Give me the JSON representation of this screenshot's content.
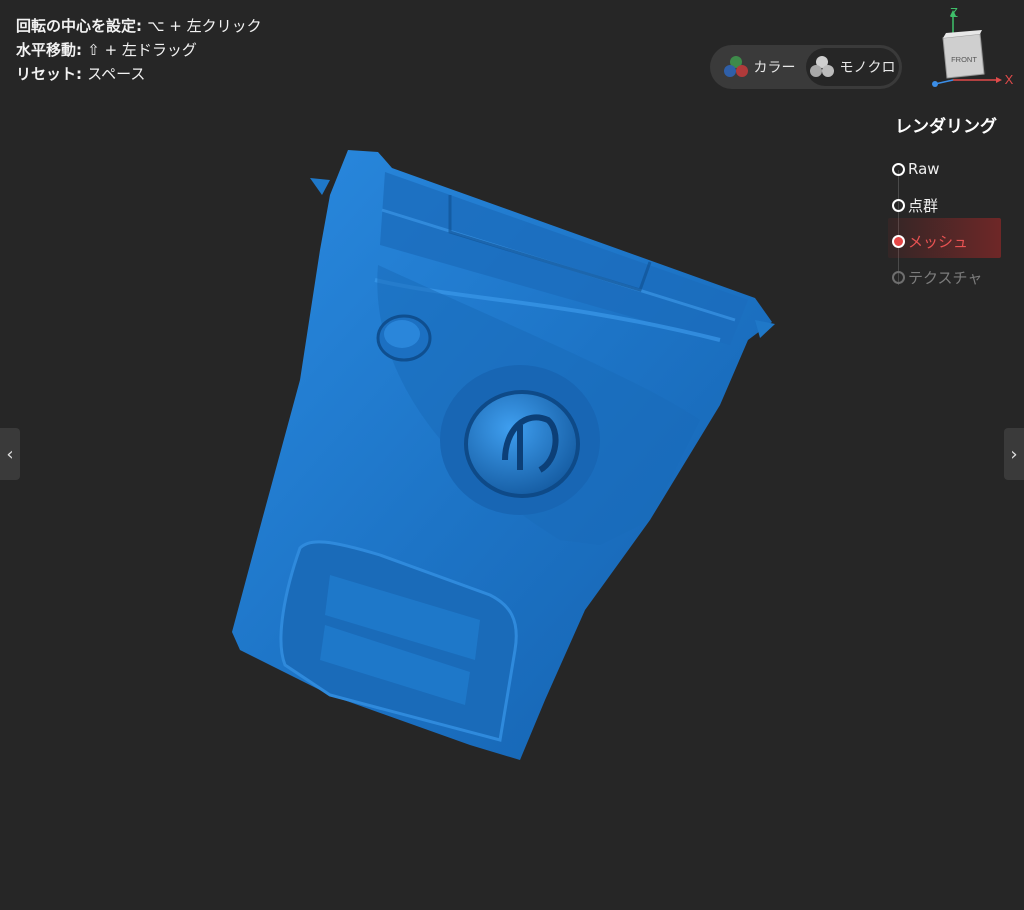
{
  "hints": {
    "rotate_label": "回転の中心を設定:",
    "rotate_keys": "⌥ + 左クリック",
    "pan_label": "水平移動:",
    "pan_keys": "⇧ + 左ドラッグ",
    "reset_label": "リセット:",
    "reset_keys": "スペース"
  },
  "mode_toggle": {
    "color_label": "カラー",
    "mono_label": "モノクロ",
    "active": "mono"
  },
  "view_cube": {
    "face_label": "FRONT",
    "axis_z": "Z",
    "axis_x": "X"
  },
  "rendering": {
    "title": "レンダリング",
    "options": [
      {
        "label": "Raw",
        "state": "normal"
      },
      {
        "label": "点群",
        "state": "normal"
      },
      {
        "label": "メッシュ",
        "state": "selected"
      },
      {
        "label": "テクスチャ",
        "state": "disabled"
      }
    ]
  },
  "colors": {
    "background": "#262626",
    "mesh": "#1f78c8",
    "accent": "#e54646"
  },
  "nav": {
    "prev_arrow": "‹",
    "next_arrow": "›"
  }
}
